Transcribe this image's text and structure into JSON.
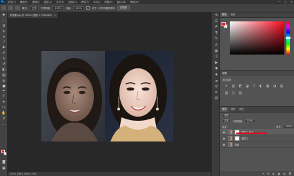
{
  "app": {
    "logo": "Ps"
  },
  "menu": [
    "文件(F)",
    "编辑(E)",
    "图像(I)",
    "图层(L)",
    "文字(Y)",
    "选择(S)",
    "滤镜(T)",
    "3D(D)",
    "视图(V)",
    "窗口(W)",
    "帮助(H)"
  ],
  "window_controls": [
    "—",
    "□",
    "✕"
  ],
  "options": {
    "mode_label": "模式:",
    "mode_value": "正常",
    "opacity_label": "不透明度:",
    "opacity_value": "100%",
    "flow_label": "流量:",
    "flow_value": "100%",
    "check_mark": "✓",
    "sample_all_label": "对齐 / 对所有图层取样",
    "button_label": "仿制源"
  },
  "document": {
    "tab_title": "测试图.jpg @ 100% (图层 1, RGB/8#)",
    "tab_close": "×",
    "status": "100%   文档:1.16M/2.31M"
  },
  "swatches": {
    "foreground": "#e31b23",
    "background": "#ffffff"
  },
  "panels": {
    "top_tabs": [
      "颜色",
      "色板"
    ],
    "adjust_title": "调整",
    "adjust_subtitle": "添加调整",
    "adjust_icons": [
      "☀",
      "▥",
      "◩",
      "◪",
      "▽",
      "◐",
      "▦",
      "◑",
      "▤",
      "▧",
      "◫",
      "▨"
    ],
    "layers_tabs": [
      "图层",
      "通道",
      "路径"
    ],
    "kind_label": "类型",
    "blend_mode": "正常",
    "opacity_label": "不透明度:",
    "opacity_value": "100%",
    "lock_label": "锁定:",
    "fill_label": "填充:",
    "fill_value": "100%",
    "layers": [
      {
        "name": "图层 1 副本",
        "visible_glyph": "◉",
        "selected": true
      },
      {
        "name": "图层 1",
        "visible_glyph": "◉",
        "selected": false
      },
      {
        "name": "背景",
        "visible_glyph": "◉",
        "selected": false
      }
    ],
    "footer_icons": [
      "⚭",
      "fx",
      "◐",
      "▣",
      "▤",
      "🗑"
    ]
  }
}
